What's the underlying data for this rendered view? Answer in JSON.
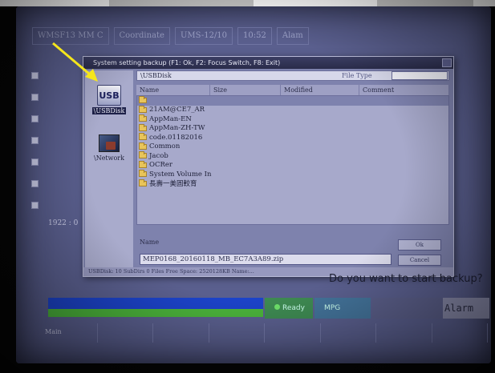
{
  "monitor": {
    "status_cells": [
      "WMSF13 MM C",
      "Coordinate",
      "UMS-12/10",
      "10:52",
      "Alam"
    ]
  },
  "dialog": {
    "title": "System setting backup (F1: Ok, F2: Focus Switch, F8: Exit)",
    "path": "\\USBDisk",
    "file_type_label": "File Type",
    "sidebar": [
      {
        "label": "\\USBDisk",
        "icon": "usb-drive-icon",
        "selected": true
      },
      {
        "label": "\\Network",
        "icon": "network-icon",
        "selected": false
      }
    ],
    "columns": [
      "Name",
      "Size",
      "Modified",
      "Comment"
    ],
    "files": [
      "",
      "21AM@CE7_AR",
      "AppMan-EN",
      "AppMan-ZH-TW",
      "code.01182016",
      "Common",
      "Jacob",
      "OCRer",
      "System Volume In",
      "長壽一美固較育"
    ],
    "name_label": "Name",
    "name_value": "MEP0168_20160118_MB_EC7A3A89.zip",
    "ok_label": "Ok",
    "cancel_label": "Cancel",
    "status": "USBDisk: 10 SubDirs 0 Files Free Space: 2520128KB Name:..."
  },
  "background": {
    "row_label": "1922 : 0",
    "prompt": "Do you want to start backup?"
  },
  "statusbar": {
    "ready_label": "Ready",
    "mpg_label": "MPG",
    "alarm_label": "Alarm"
  },
  "bottom_tab": "Main",
  "colors": {
    "screen_bg": "#5a5f8e",
    "progress_blue": "#1c43c9",
    "progress_green": "#4bb33b",
    "ready_green": "#3e8a52",
    "arrow_yellow": "#f5e61c"
  }
}
